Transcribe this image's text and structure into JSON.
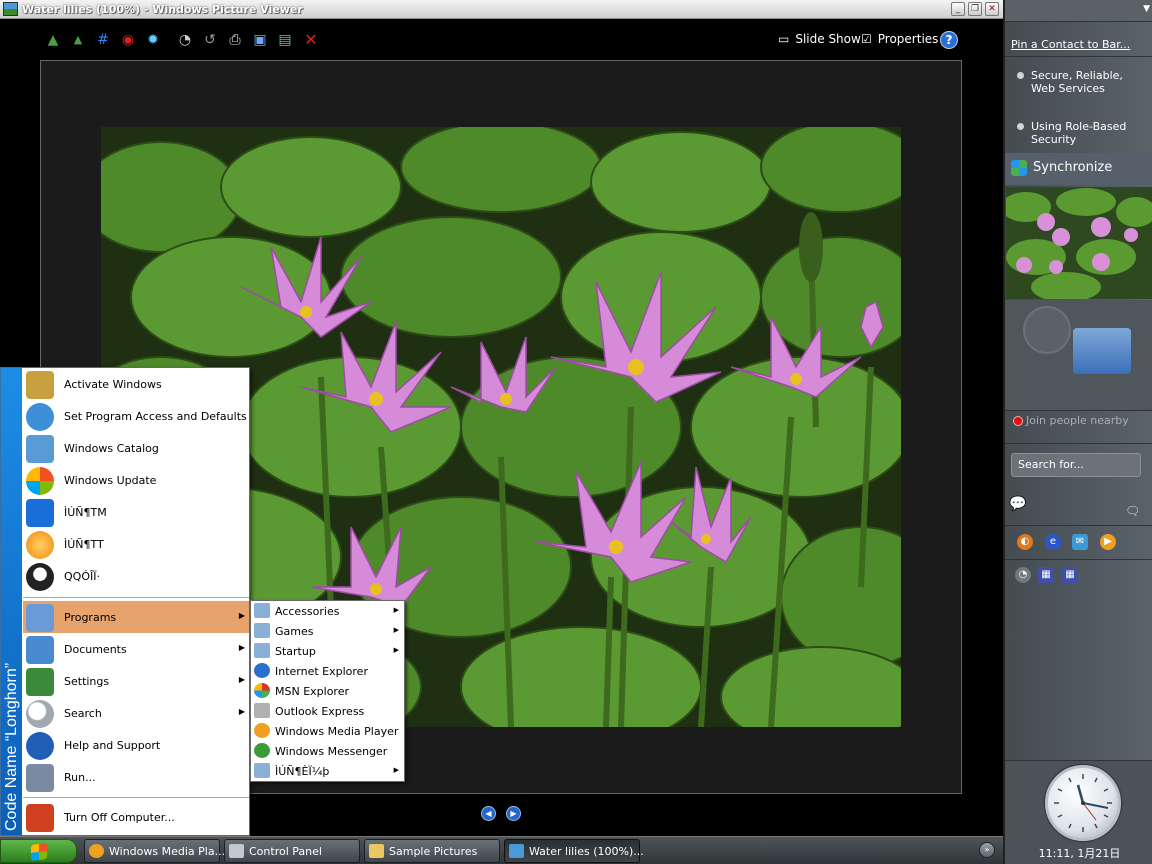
{
  "window": {
    "title": "Water lilies (100%) - Windows Picture Viewer",
    "minimize": "_",
    "maximize": "❐",
    "close": "✕"
  },
  "toolbar": {
    "slideshow_label": "Slide Show",
    "properties_label": "Properties",
    "help_label": "?",
    "icons": [
      "zoom-in",
      "zoom-out",
      "crop",
      "red-eye",
      "brightness",
      "adjust",
      "rotate",
      "print",
      "save",
      "copy",
      "delete"
    ]
  },
  "viewer": {
    "prev_label": "◀",
    "next_label": "▶"
  },
  "sidebar": {
    "pin_contact": "Pin a Contact to Bar...",
    "news_items": [
      "Secure, Reliable, Web Services",
      "Using Role-Based Security"
    ],
    "sync_label": "Synchronize",
    "join_label": "Join people nearby",
    "search_placeholder": "Search for...",
    "clock_time": "11:11, 1月21日"
  },
  "start_menu": {
    "band_text": "Code Name “Longhorn”",
    "pinned": [
      {
        "label": "Activate Windows",
        "color": "#c8a040"
      },
      {
        "label": "Set Program Access and Defaults",
        "color": "#3d8fd8"
      },
      {
        "label": "Windows Catalog",
        "color": "#5b9bd5"
      },
      {
        "label": "Windows Update",
        "color": "#2e7ed0"
      },
      {
        "label": "ÌÚÑ¶TM",
        "color": "#1a6ed8"
      },
      {
        "label": "ÌÚÑ¶TT",
        "color": "#f08a10"
      },
      {
        "label": "QQÓÎÏ·",
        "color": "#222222"
      }
    ],
    "items": [
      {
        "label": "Programs",
        "arrow": "▶",
        "color": "#6a9bd8"
      },
      {
        "label": "Documents",
        "arrow": "▶",
        "color": "#4a8ad0"
      },
      {
        "label": "Settings",
        "arrow": "▶",
        "color": "#3b8a3b"
      },
      {
        "label": "Search",
        "arrow": "▶",
        "color": "#a0a8b0"
      },
      {
        "label": "Help and Support",
        "arrow": "",
        "color": "#1f5fb8"
      },
      {
        "label": "Run...",
        "arrow": "",
        "color": "#7a8aa0"
      }
    ],
    "turn_off": {
      "label": "Turn Off Computer...",
      "color": "#d04020"
    }
  },
  "programs_submenu": [
    {
      "label": "Accessories",
      "arrow": "▶",
      "color": "#8ab0d8"
    },
    {
      "label": "Games",
      "arrow": "▶",
      "color": "#8ab0d8"
    },
    {
      "label": "Startup",
      "arrow": "▶",
      "color": "#8ab0d8"
    },
    {
      "label": "Internet Explorer",
      "arrow": "",
      "color": "#2a6fd0"
    },
    {
      "label": "MSN Explorer",
      "arrow": "",
      "color": "#4caf50"
    },
    {
      "label": "Outlook Express",
      "arrow": "",
      "color": "#b0b0b0"
    },
    {
      "label": "Windows Media Player",
      "arrow": "",
      "color": "#f0a020"
    },
    {
      "label": "Windows Messenger",
      "arrow": "",
      "color": "#3b9b3b"
    },
    {
      "label": "ÌÚÑ¶ÈÏ¼þ",
      "arrow": "▶",
      "color": "#8ab0d8"
    }
  ],
  "taskbar": {
    "tasks": [
      {
        "label": "Windows Media Pla...",
        "color": "#f0a020",
        "active": false
      },
      {
        "label": "Control Panel",
        "color": "#c0c8d0",
        "active": false
      },
      {
        "label": "Sample Pictures",
        "color": "#e8c860",
        "active": false
      },
      {
        "label": "Water lilies (100%)...",
        "color": "#4a9ad8",
        "active": true
      }
    ],
    "tray_chevron": "»"
  }
}
